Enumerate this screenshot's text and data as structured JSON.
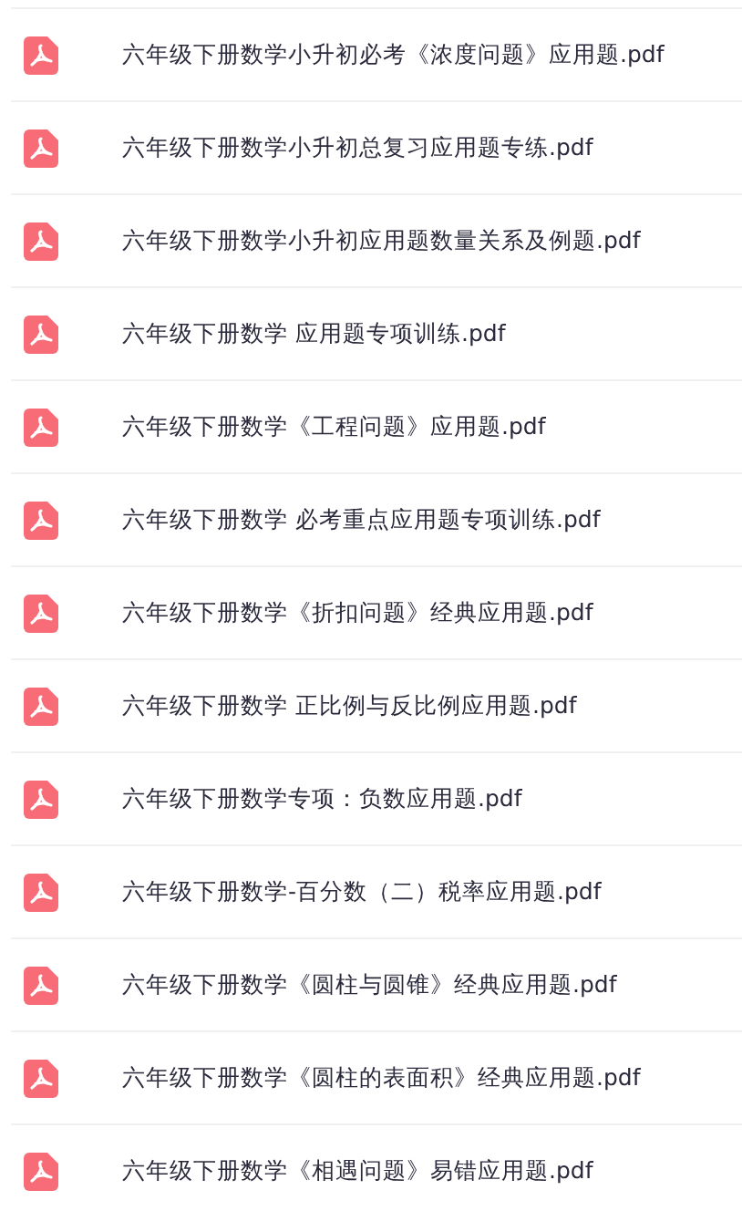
{
  "files": [
    {
      "name": "六年级下册数学小升初必考《浓度问题》应用题.pdf"
    },
    {
      "name": "六年级下册数学小升初总复习应用题专练.pdf"
    },
    {
      "name": "六年级下册数学小升初应用题数量关系及例题.pdf"
    },
    {
      "name": "六年级下册数学 应用题专项训练.pdf"
    },
    {
      "name": "六年级下册数学《工程问题》应用题.pdf"
    },
    {
      "name": "六年级下册数学 必考重点应用题专项训练.pdf"
    },
    {
      "name": "六年级下册数学《折扣问题》经典应用题.pdf"
    },
    {
      "name": "六年级下册数学 正比例与反比例应用题.pdf"
    },
    {
      "name": "六年级下册数学专项：负数应用题.pdf"
    },
    {
      "name": "六年级下册数学-百分数（二）税率应用题.pdf"
    },
    {
      "name": "六年级下册数学《圆柱与圆锥》经典应用题.pdf"
    },
    {
      "name": "六年级下册数学《圆柱的表面积》经典应用题.pdf"
    },
    {
      "name": "六年级下册数学《相遇问题》易错应用题.pdf"
    }
  ]
}
